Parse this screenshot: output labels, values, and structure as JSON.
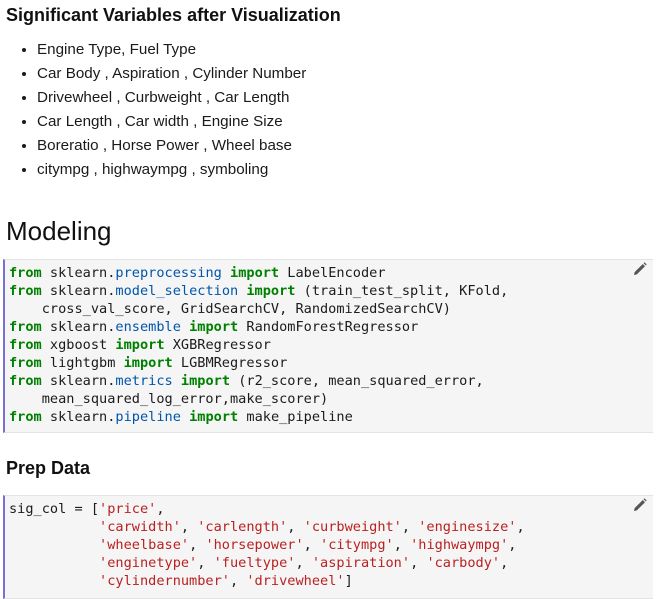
{
  "sections": {
    "variables_title": "Significant Variables after Visualization",
    "variables": [
      "Engine Type, Fuel Type",
      "Car Body , Aspiration , Cylinder Number",
      "Drivewheel , Curbweight , Car Length",
      "Car Length , Car width , Engine Size",
      "Boreratio , Horse Power , Wheel base",
      "citympg , highwaympg , symboling"
    ],
    "modeling_title": "Modeling",
    "prep_title": "Prep Data"
  },
  "cells": {
    "imports": {
      "lines": [
        [
          [
            "kw",
            "from"
          ],
          [
            "t",
            " sklearn."
          ],
          [
            "mod",
            "preprocessing"
          ],
          [
            "t",
            " "
          ],
          [
            "kw",
            "import"
          ],
          [
            "t",
            " LabelEncoder"
          ]
        ],
        [
          [
            "kw",
            "from"
          ],
          [
            "t",
            " sklearn."
          ],
          [
            "mod",
            "model_selection"
          ],
          [
            "t",
            " "
          ],
          [
            "kw",
            "import"
          ],
          [
            "t",
            " (train_test_split, KFold,"
          ]
        ],
        [
          [
            "t",
            "    cross_val_score, GridSearchCV, RandomizedSearchCV)"
          ]
        ],
        [
          [
            "kw",
            "from"
          ],
          [
            "t",
            " sklearn."
          ],
          [
            "mod",
            "ensemble"
          ],
          [
            "t",
            " "
          ],
          [
            "kw",
            "import"
          ],
          [
            "t",
            " RandomForestRegressor"
          ]
        ],
        [
          [
            "kw",
            "from"
          ],
          [
            "t",
            " xgboost "
          ],
          [
            "kw",
            "import"
          ],
          [
            "t",
            " XGBRegressor"
          ]
        ],
        [
          [
            "kw",
            "from"
          ],
          [
            "t",
            " lightgbm "
          ],
          [
            "kw",
            "import"
          ],
          [
            "t",
            " LGBMRegressor"
          ]
        ],
        [
          [
            "kw",
            "from"
          ],
          [
            "t",
            " sklearn."
          ],
          [
            "mod",
            "metrics"
          ],
          [
            "t",
            " "
          ],
          [
            "kw",
            "import"
          ],
          [
            "t",
            " (r2_score, mean_squared_error,"
          ]
        ],
        [
          [
            "t",
            "    mean_squared_log_error,make_scorer)"
          ]
        ],
        [
          [
            "kw",
            "from"
          ],
          [
            "t",
            " sklearn."
          ],
          [
            "mod",
            "pipeline"
          ],
          [
            "t",
            " "
          ],
          [
            "kw",
            "import"
          ],
          [
            "t",
            " make_pipeline"
          ]
        ]
      ]
    },
    "sig_col": {
      "lines": [
        [
          [
            "t",
            "sig_col = ["
          ],
          [
            "str",
            "'price'"
          ],
          [
            "t",
            ","
          ]
        ],
        [
          [
            "t",
            "           "
          ],
          [
            "str",
            "'carwidth'"
          ],
          [
            "t",
            ", "
          ],
          [
            "str",
            "'carlength'"
          ],
          [
            "t",
            ", "
          ],
          [
            "str",
            "'curbweight'"
          ],
          [
            "t",
            ", "
          ],
          [
            "str",
            "'enginesize'"
          ],
          [
            "t",
            ","
          ]
        ],
        [
          [
            "t",
            "           "
          ],
          [
            "str",
            "'wheelbase'"
          ],
          [
            "t",
            ", "
          ],
          [
            "str",
            "'horsepower'"
          ],
          [
            "t",
            ", "
          ],
          [
            "str",
            "'citympg'"
          ],
          [
            "t",
            ", "
          ],
          [
            "str",
            "'highwaympg'"
          ],
          [
            "t",
            ","
          ]
        ],
        [
          [
            "t",
            "           "
          ],
          [
            "str",
            "'enginetype'"
          ],
          [
            "t",
            ", "
          ],
          [
            "str",
            "'fueltype'"
          ],
          [
            "t",
            ", "
          ],
          [
            "str",
            "'aspiration'"
          ],
          [
            "t",
            ", "
          ],
          [
            "str",
            "'carbody'"
          ],
          [
            "t",
            ","
          ]
        ],
        [
          [
            "t",
            "           "
          ],
          [
            "str",
            "'cylindernumber'"
          ],
          [
            "t",
            ", "
          ],
          [
            "str",
            "'drivewheel'"
          ],
          [
            "t",
            "]"
          ]
        ]
      ]
    }
  },
  "icons": {
    "edit": "pencil-icon"
  }
}
